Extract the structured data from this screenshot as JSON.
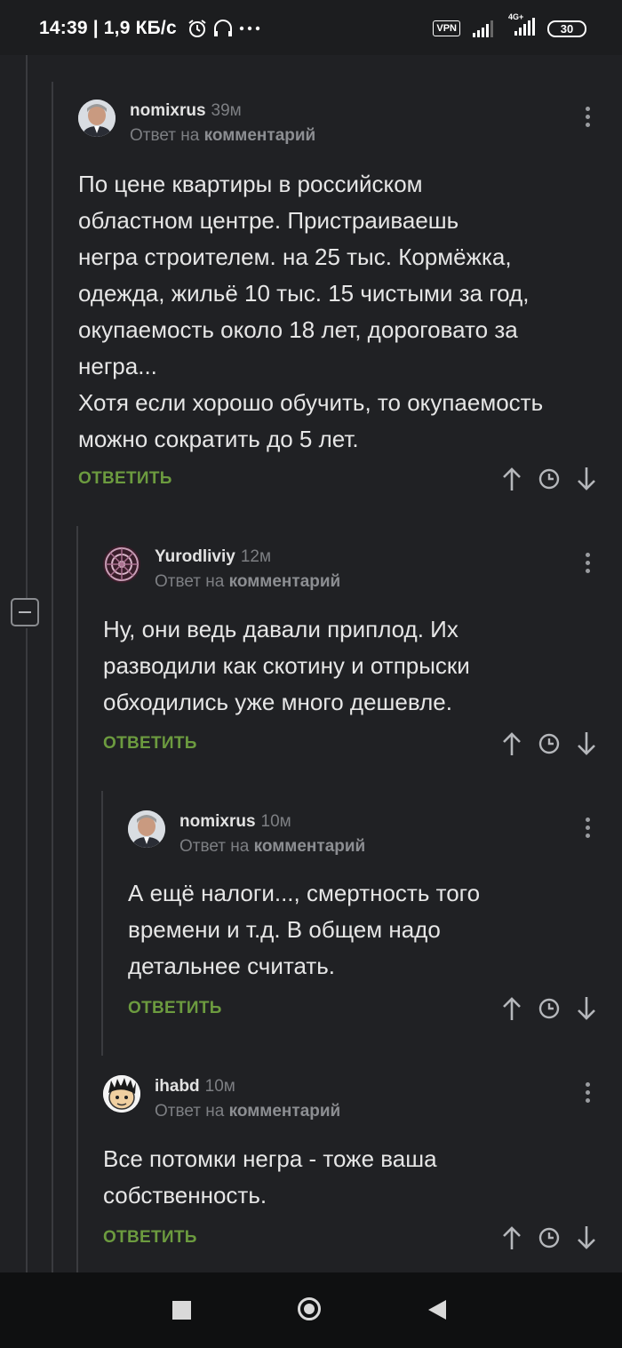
{
  "status_bar": {
    "time": "14:39",
    "speed": "1,9 КБ/с",
    "vpn": "VPN",
    "network": "4G+",
    "battery": "30"
  },
  "comments": [
    {
      "username": "nomixrus",
      "time": "39м",
      "reply_prefix": "Ответ на",
      "reply_target": "комментарий",
      "lines": [
        "По цене квартиры в российском",
        "областном центре. Пристраиваешь",
        "негра строителем. на 25 тыс. Кормёжка,",
        "одежда, жильё 10 тыс. 15 чистыми за год,",
        "окупаемость около 18 лет, дороговато за",
        "негра...",
        "Хотя если хорошо обучить, то окупаемость",
        "можно сократить до 5 лет."
      ],
      "reply_label": "ОТВЕТИТЬ"
    },
    {
      "username": "Yurodliviy",
      "time": "12м",
      "reply_prefix": "Ответ на",
      "reply_target": "комментарий",
      "lines": [
        "Ну, они ведь давали приплод. Их",
        "разводили как скотину и отпрыски",
        "обходились уже много дешевле."
      ],
      "reply_label": "ОТВЕТИТЬ"
    },
    {
      "username": "nomixrus",
      "time": "10м",
      "reply_prefix": "Ответ на",
      "reply_target": "комментарий",
      "lines": [
        "А ещё налоги..., смертность того",
        "времени и т.д. В общем надо",
        "детальнее считать."
      ],
      "reply_label": "ОТВЕТИТЬ"
    },
    {
      "username": "ihabd",
      "time": "10м",
      "reply_prefix": "Ответ на",
      "reply_target": "комментарий",
      "lines": [
        "Все потомки негра - тоже ваша",
        "собственность."
      ],
      "reply_label": "ОТВЕТИТЬ"
    }
  ],
  "icons": {
    "upvote": "arrow-up-icon",
    "clock": "clock-icon",
    "downvote": "arrow-down-icon",
    "more": "kebab-menu-icon",
    "collapse": "minus-icon"
  },
  "colors": {
    "background": "#202124",
    "reply_button": "#6c9b3f",
    "muted_text": "#7d7f83"
  }
}
